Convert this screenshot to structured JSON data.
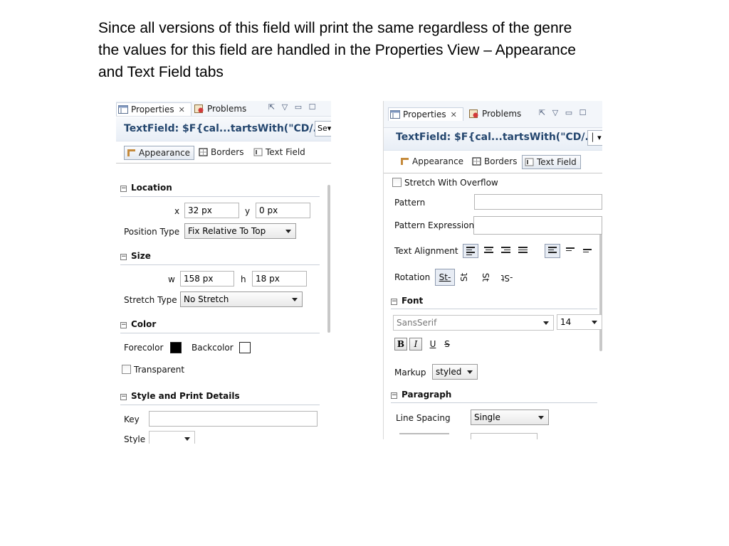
{
  "caption": {
    "line1": "Since all versions of this field will print the same regardless of the genre",
    "line2": "the values for this field are handled in the Properties View – Appearance",
    "line3": "and Text Field tabs"
  },
  "left": {
    "tabs": {
      "properties": "Properties",
      "problems": "Problems",
      "close": "✕"
    },
    "view_tools": {
      "pin": "⇱",
      "menu": "▽",
      "minimize": "▭",
      "maximize": "☐"
    },
    "title": "TextField: $F{cal...tartsWith(\"CD/...",
    "title_combo": "Se",
    "subtabs": {
      "appearance": "Appearance",
      "borders": "Borders",
      "text_field": "Text Field"
    },
    "location": {
      "header": "Location",
      "x_label": "x",
      "x_value": "32 px",
      "y_label": "y",
      "y_value": "0 px",
      "position_type_label": "Position Type",
      "position_type_value": "Fix Relative To Top"
    },
    "size": {
      "header": "Size",
      "w_label": "w",
      "w_value": "158 px",
      "h_label": "h",
      "h_value": "18 px",
      "stretch_type_label": "Stretch Type",
      "stretch_type_value": "No Stretch"
    },
    "color": {
      "header": "Color",
      "forecolor_label": "Forecolor",
      "forecolor": "#000000",
      "backcolor_label": "Backcolor",
      "backcolor": "#ffffff",
      "transparent_label": "Transparent"
    },
    "style_print": {
      "header": "Style and Print Details",
      "key_label": "Key",
      "style_label": "Style"
    }
  },
  "right": {
    "tabs": {
      "properties": "Properties",
      "problems": "Problems",
      "close": "✕"
    },
    "view_tools": {
      "pin": "⇱",
      "menu": "▽",
      "minimize": "▭",
      "maximize": "☐"
    },
    "title": "TextField: $F{cal...tartsWith(\"CD/...",
    "subtabs": {
      "appearance": "Appearance",
      "borders": "Borders",
      "text_field": "Text Field"
    },
    "stretch_with_overflow": "Stretch With Overflow",
    "pattern_label": "Pattern",
    "pattern_expression_label": "Pattern Expression",
    "text_alignment_label": "Text Alignment",
    "rotation_label": "Rotation",
    "rotation_options": {
      "none": "St-",
      "left": "St",
      "right": "St",
      "flip": "-St"
    },
    "font": {
      "header": "Font",
      "family": "SansSerif",
      "size": "14",
      "bold": "B",
      "italic": "I",
      "underline": "U",
      "strike": "S"
    },
    "markup_label": "Markup",
    "markup_value": "styled",
    "paragraph": {
      "header": "Paragraph",
      "line_spacing_label": "Line Spacing",
      "line_spacing_value": "Single"
    }
  }
}
